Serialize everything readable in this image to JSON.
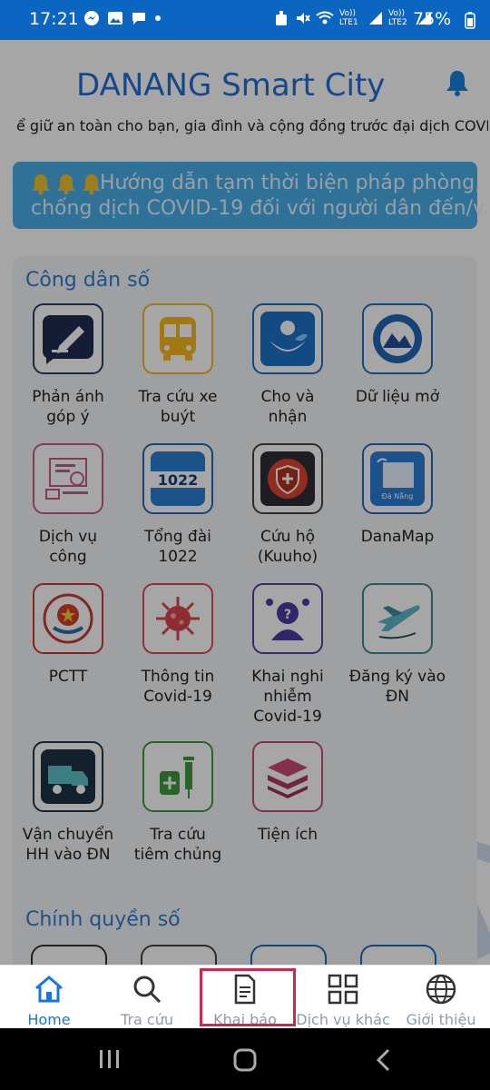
{
  "status_bar": {
    "time": "17:21",
    "left_icons": [
      "messenger-icon",
      "gallery-icon",
      "chat-icon",
      "dot-icon"
    ],
    "right_icons": [
      "alarm-icon",
      "mute-icon",
      "wifi-icon",
      "lte1-signal",
      "lte2-signal"
    ],
    "lte1_label": "Vo)) LTE1",
    "lte2_label": "Vo)) LTE2",
    "battery": "75%"
  },
  "header": {
    "title": "DANANG Smart City",
    "bell_icon": "bell-icon"
  },
  "marquee": "ể giữ an toàn cho bạn, gia đình và cộng đồng trước đại dịch COVID",
  "notice": {
    "line1": "Hướng dẫn tạm thời biện pháp phòng,",
    "line2": "chống dịch COVID-19 đối với người dân đến/v..."
  },
  "sections": {
    "digital_citizen": "Công dân số",
    "digital_government": "Chính quyền số"
  },
  "tiles": [
    {
      "label": "Phản ánh\ngóp ý",
      "icon": "feedback-icon"
    },
    {
      "label": "Tra cứu xe\nbuýt",
      "icon": "bus-icon"
    },
    {
      "label": "Cho và\nnhận",
      "icon": "give-receive-icon"
    },
    {
      "label": "Dữ liệu mở",
      "icon": "open-data-icon"
    },
    {
      "label": "Dịch vụ\ncông",
      "icon": "public-service-icon"
    },
    {
      "label": "Tổng đài\n1022",
      "icon": "hotline-icon"
    },
    {
      "label": "Cứu hộ\n(Kuuho)",
      "icon": "rescue-icon"
    },
    {
      "label": "DanaMap",
      "icon": "map-icon"
    },
    {
      "label": "PCTT",
      "icon": "disaster-prevention-icon"
    },
    {
      "label": "Thông tin\nCovid-19",
      "icon": "virus-icon"
    },
    {
      "label": "Khai nghi\nnhiễm\nCovid-19",
      "icon": "suspect-icon"
    },
    {
      "label": "Đăng ký vào\nĐN",
      "icon": "plane-icon"
    },
    {
      "label": "Vận chuyển\nHH vào ĐN",
      "icon": "truck-icon"
    },
    {
      "label": "Tra cứu\ntiêm chủng",
      "icon": "vaccine-icon"
    },
    {
      "label": "Tiện ích",
      "icon": "layers-icon"
    }
  ],
  "bottom_nav": [
    {
      "label": "Home",
      "icon": "home-icon"
    },
    {
      "label": "Tra cứu",
      "icon": "search-icon"
    },
    {
      "label": "Khai báo",
      "icon": "document-icon"
    },
    {
      "label": "Dịch vụ khác",
      "icon": "grid-icon"
    },
    {
      "label": "Giới thiệu",
      "icon": "globe-icon"
    }
  ],
  "colors": {
    "status_bar": "#0b66c2",
    "title": "#1f6fd6",
    "section_title": "#2f7fd0",
    "notice_bg": "#49aee9",
    "active_nav": "#1777d6",
    "highlight": "#d6254b"
  }
}
